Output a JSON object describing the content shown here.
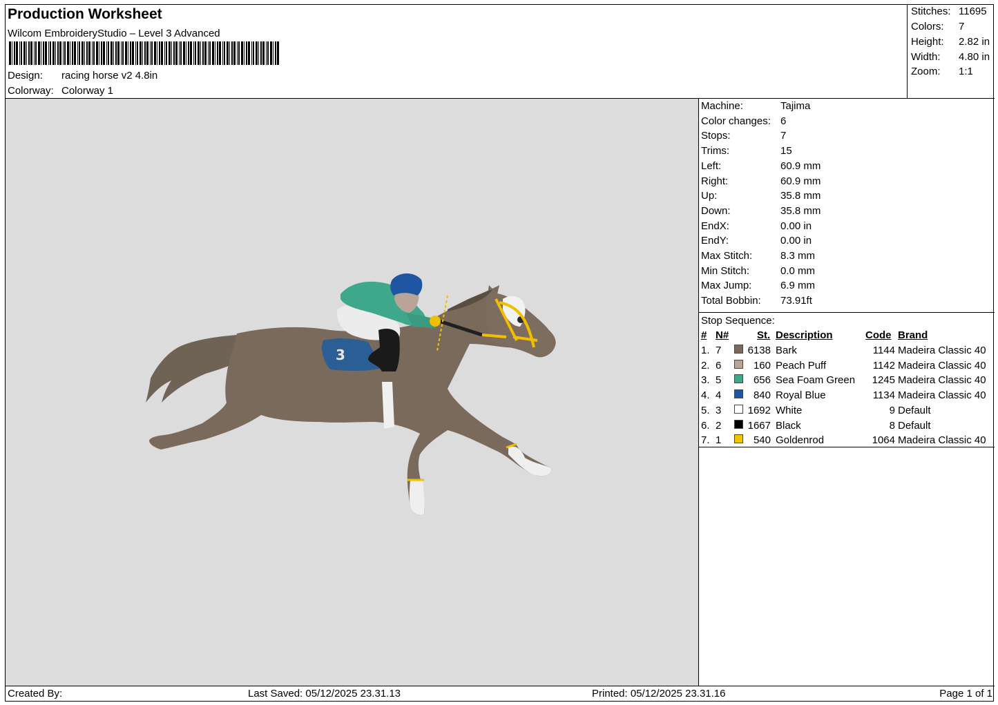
{
  "header": {
    "title": "Production Worksheet",
    "software": "Wilcom EmbroideryStudio – Level 3 Advanced",
    "design_label": "Design:",
    "design_value": "racing horse v2 4.8in",
    "colorway_label": "Colorway:",
    "colorway_value": "Colorway 1"
  },
  "stats": [
    {
      "label": "Stitches:",
      "value": "11695"
    },
    {
      "label": "Colors:",
      "value": "7"
    },
    {
      "label": "Height:",
      "value": "2.82 in"
    },
    {
      "label": "Width:",
      "value": "4.80 in"
    },
    {
      "label": "Zoom:",
      "value": "1:1"
    }
  ],
  "machine": [
    {
      "label": "Machine:",
      "value": "Tajima"
    },
    {
      "label": "Color changes:",
      "value": "6"
    },
    {
      "label": "Stops:",
      "value": "7"
    },
    {
      "label": "Trims:",
      "value": "15"
    },
    {
      "label": "Left:",
      "value": "60.9 mm"
    },
    {
      "label": "Right:",
      "value": "60.9 mm"
    },
    {
      "label": "Up:",
      "value": "35.8 mm"
    },
    {
      "label": "Down:",
      "value": "35.8 mm"
    },
    {
      "label": "EndX:",
      "value": "0.00 in"
    },
    {
      "label": "EndY:",
      "value": "0.00 in"
    },
    {
      "label": "Max Stitch:",
      "value": "8.3 mm"
    },
    {
      "label": "Min Stitch:",
      "value": "0.0 mm"
    },
    {
      "label": "Max Jump:",
      "value": "6.9 mm"
    },
    {
      "label": "Total Bobbin:",
      "value": "73.91ft"
    }
  ],
  "stop_sequence": {
    "title": "Stop Sequence:",
    "headers": {
      "num": "#",
      "n": "N#",
      "st": "St.",
      "desc": "Description",
      "code": "Code",
      "brand": "Brand"
    },
    "rows": [
      {
        "num": "1.",
        "n": "7",
        "color": "#7a6a5c",
        "st": "6138",
        "desc": "Bark",
        "code": "1144",
        "brand": "Madeira Classic 40"
      },
      {
        "num": "2.",
        "n": "6",
        "color": "#b8a597",
        "st": "160",
        "desc": "Peach Puff",
        "code": "1142",
        "brand": "Madeira Classic 40"
      },
      {
        "num": "3.",
        "n": "5",
        "color": "#3fa88a",
        "st": "656",
        "desc": "Sea Foam Green",
        "code": "1245",
        "brand": "Madeira Classic 40"
      },
      {
        "num": "4.",
        "n": "4",
        "color": "#1f56a3",
        "st": "840",
        "desc": "Royal Blue",
        "code": "1134",
        "brand": "Madeira Classic 40"
      },
      {
        "num": "5.",
        "n": "3",
        "color": "#ffffff",
        "st": "1692",
        "desc": "White",
        "code": "9",
        "brand": "Default"
      },
      {
        "num": "6.",
        "n": "2",
        "color": "#000000",
        "st": "1667",
        "desc": "Black",
        "code": "8",
        "brand": "Default"
      },
      {
        "num": "7.",
        "n": "1",
        "color": "#f2c200",
        "st": "540",
        "desc": "Goldenrod",
        "code": "1064",
        "brand": "Madeira Classic 40"
      }
    ]
  },
  "footer": {
    "created_by": "Created By:",
    "last_saved": "Last Saved: 05/12/2025 23.31.13",
    "printed": "Printed: 05/12/2025 23.31.16",
    "page": "Page 1 of 1"
  }
}
